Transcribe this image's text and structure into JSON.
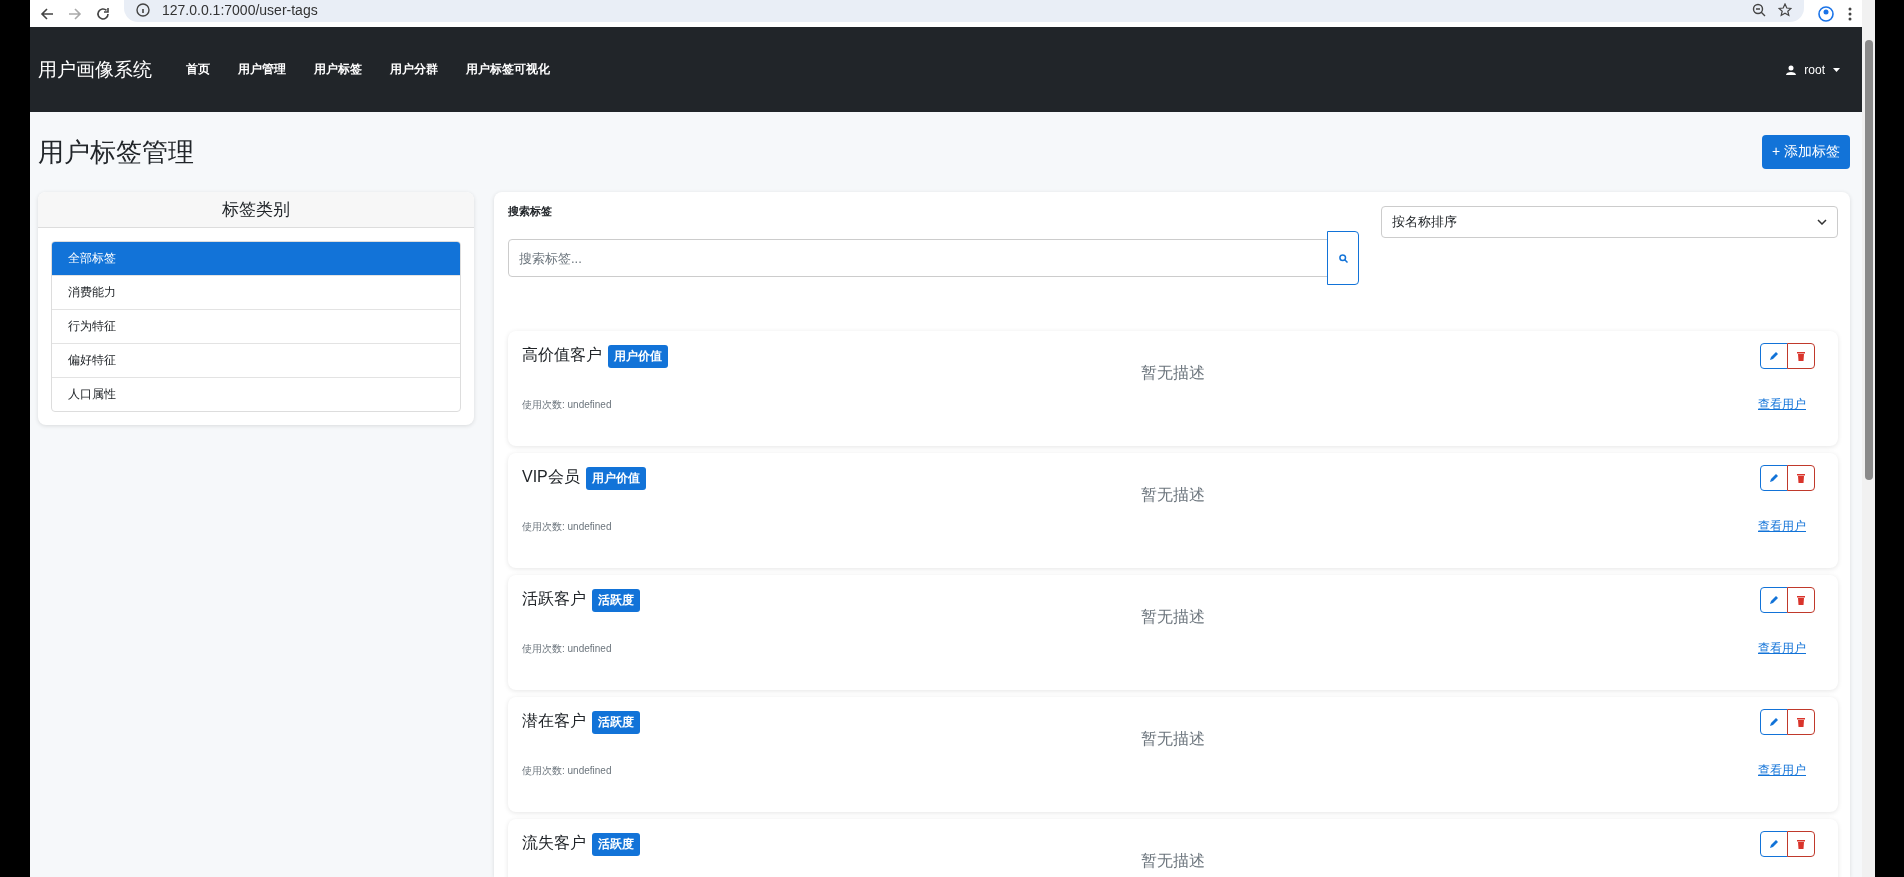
{
  "browser": {
    "url": "127.0.0.1:7000/user-tags"
  },
  "navbar": {
    "brand": "用户画像系统",
    "links": [
      "首页",
      "用户管理",
      "用户标签",
      "用户分群",
      "用户标签可视化"
    ],
    "user": "root"
  },
  "page": {
    "title": "用户标签管理",
    "add_button": "+ 添加标签"
  },
  "categories": {
    "title": "标签类别",
    "items": [
      {
        "label": "全部标签",
        "selected": true
      },
      {
        "label": "消费能力",
        "selected": false
      },
      {
        "label": "行为特征",
        "selected": false
      },
      {
        "label": "偏好特征",
        "selected": false
      },
      {
        "label": "人口属性",
        "selected": false
      }
    ]
  },
  "search": {
    "label": "搜索标签",
    "placeholder": "搜索标签...",
    "sort": "按名称排序"
  },
  "tags": [
    {
      "name": "高价值客户",
      "category": "用户价值",
      "description": "暂无描述",
      "usage": "使用次数: undefined",
      "link": "查看用户"
    },
    {
      "name": "VIP会员",
      "category": "用户价值",
      "description": "暂无描述",
      "usage": "使用次数: undefined",
      "link": "查看用户"
    },
    {
      "name": "活跃客户",
      "category": "活跃度",
      "description": "暂无描述",
      "usage": "使用次数: undefined",
      "link": "查看用户"
    },
    {
      "name": "潜在客户",
      "category": "活跃度",
      "description": "暂无描述",
      "usage": "使用次数: undefined",
      "link": "查看用户"
    },
    {
      "name": "流失客户",
      "category": "活跃度",
      "description": "暂无描述"
    }
  ]
}
